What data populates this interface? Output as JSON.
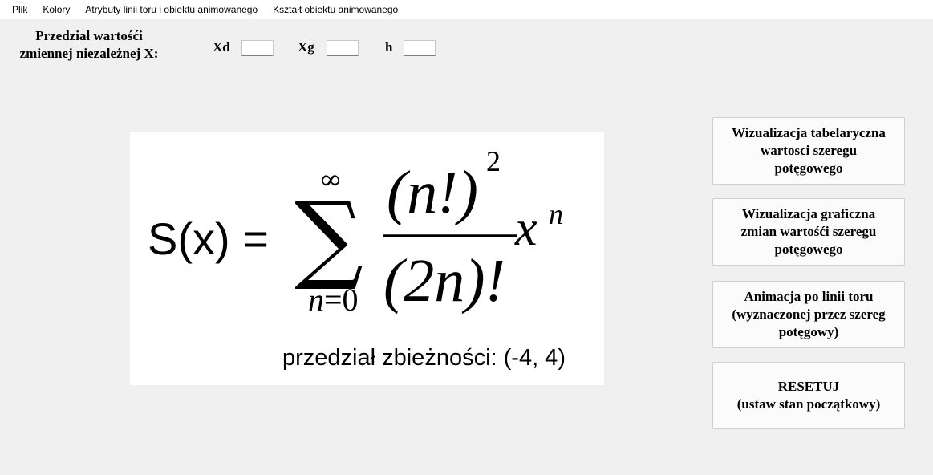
{
  "menu": {
    "items": [
      "Plik",
      "Kolory",
      "Atrybuty linii toru i obiektu animowanego",
      "Kształt obiektu animowanego"
    ]
  },
  "range": {
    "label": "Przedział wartośći\nzmiennej niezależnej X:",
    "xd_label": "Xd",
    "xd_value": "",
    "xg_label": "Xg",
    "xg_value": "",
    "h_label": "h",
    "h_value": ""
  },
  "formula": {
    "lhs": "S(x) =",
    "sigma": "∑",
    "sum_top": "∞",
    "sum_bottom_n": "n",
    "sum_bottom_eq": "=0",
    "numerator_paren": "(n!)",
    "numerator_exp": "2",
    "denominator": "(2n)!",
    "power_base": "x",
    "power_exp": "n",
    "convergence": "przedział zbieżności: (-4, 4)"
  },
  "buttons": {
    "tabular": "Wizualizacja tabelaryczna\nwartosci szeregu\npotęgowego",
    "graphic": "Wizualizacja graficzna\nzmian wartośći szeregu\npotęgowego",
    "animation": "Animacja po linii toru\n(wyznaczonej przez szereg\npotęgowy)",
    "reset": "RESETUJ\n(ustaw stan początkowy)"
  }
}
